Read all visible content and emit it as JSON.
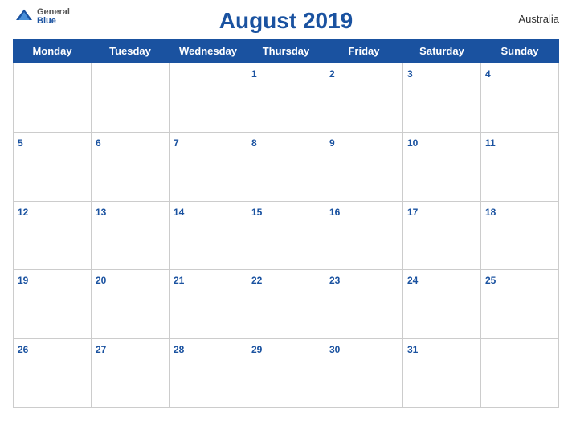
{
  "header": {
    "title": "August 2019",
    "country": "Australia",
    "logo": {
      "line1": "General",
      "line2": "Blue"
    }
  },
  "weekdays": [
    "Monday",
    "Tuesday",
    "Wednesday",
    "Thursday",
    "Friday",
    "Saturday",
    "Sunday"
  ],
  "weeks": [
    [
      null,
      null,
      null,
      1,
      2,
      3,
      4
    ],
    [
      5,
      6,
      7,
      8,
      9,
      10,
      11
    ],
    [
      12,
      13,
      14,
      15,
      16,
      17,
      18
    ],
    [
      19,
      20,
      21,
      22,
      23,
      24,
      25
    ],
    [
      26,
      27,
      28,
      29,
      30,
      31,
      null
    ]
  ]
}
